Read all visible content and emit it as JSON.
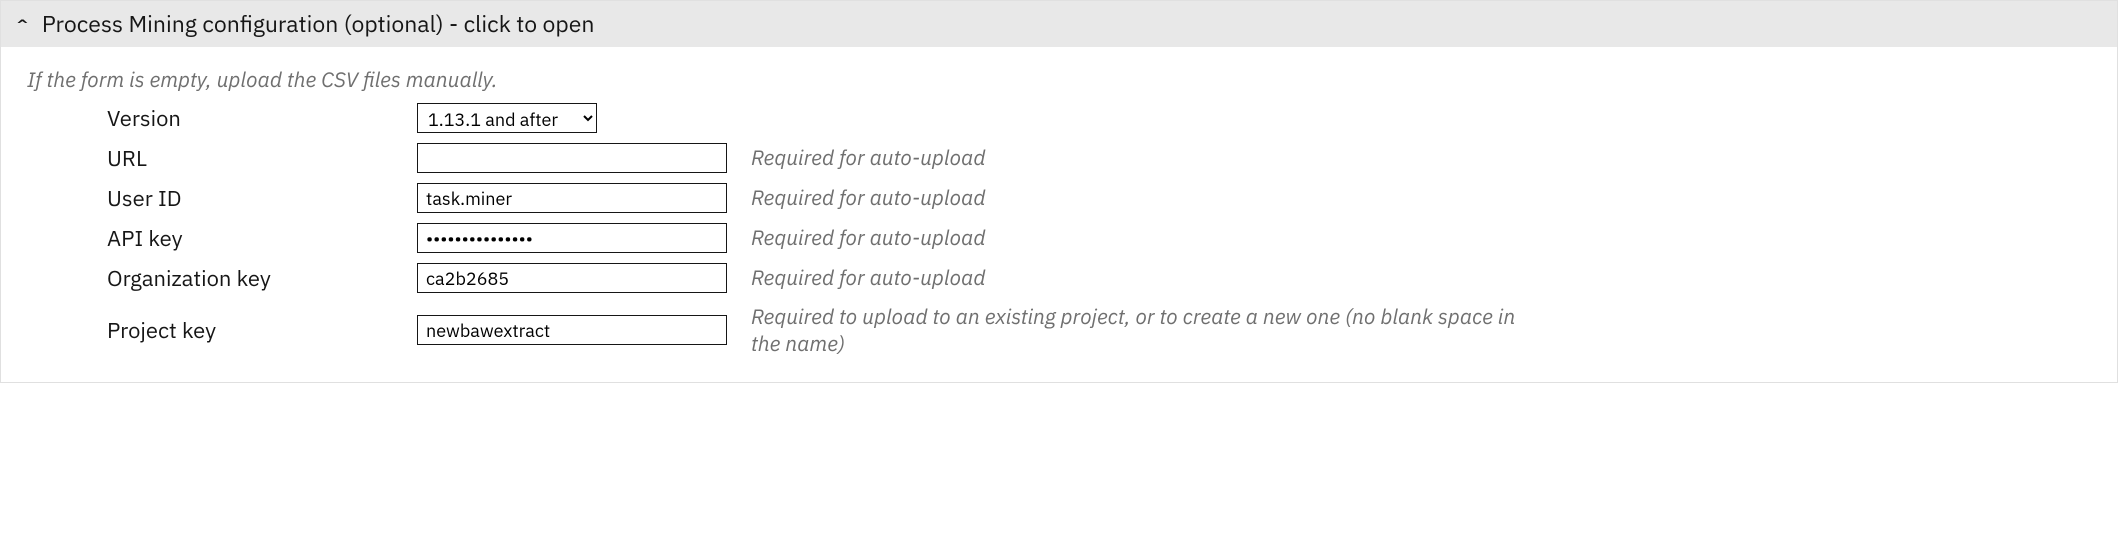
{
  "header": {
    "title": "Process Mining configuration (optional) - click to open",
    "caret": "^"
  },
  "helper_text": "If the form is empty, upload the CSV files manually.",
  "fields": {
    "version": {
      "label": "Version",
      "value": "1.13.1 and after"
    },
    "url": {
      "label": "URL",
      "value": "",
      "hint": "Required for auto-upload"
    },
    "user_id": {
      "label": "User ID",
      "value": "task.miner",
      "hint": "Required for auto-upload"
    },
    "api_key": {
      "label": "API key",
      "value": "•••••••••••••••",
      "hint": "Required for auto-upload"
    },
    "org_key": {
      "label": "Organization key",
      "value": "ca2b2685",
      "hint": "Required for auto-upload"
    },
    "project_key": {
      "label": "Project key",
      "value": "newbawextract",
      "hint": "Required to upload to an existing project, or to create a new one (no blank space in the name)"
    }
  }
}
